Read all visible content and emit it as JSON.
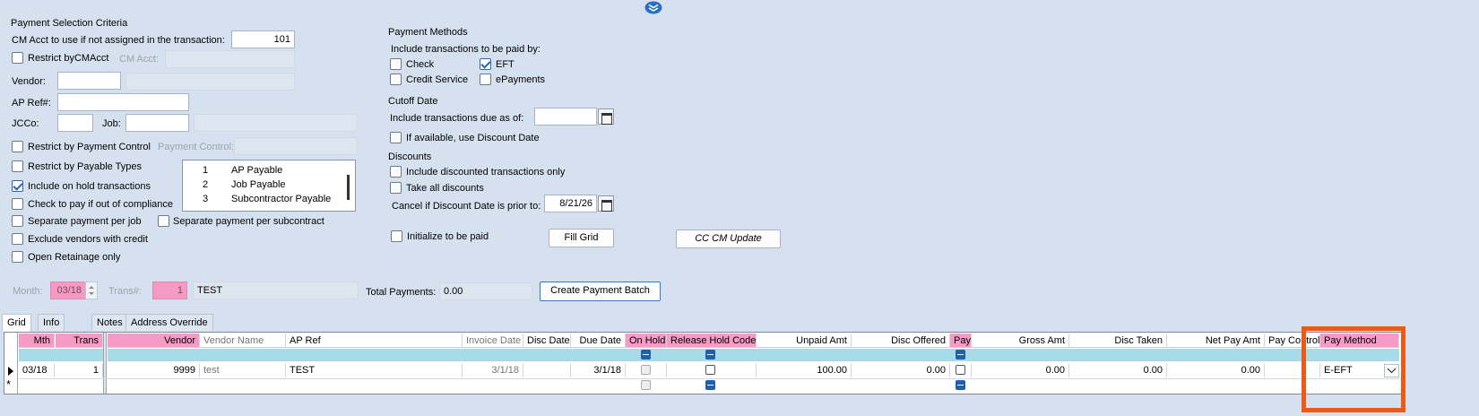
{
  "criteria": {
    "section_title": "Payment Selection Criteria",
    "cm_acct_label": "CM Acct to use if not assigned in the transaction:",
    "cm_acct_value": "101",
    "restrict_cmacct_label": "Restrict byCMAcct",
    "cm_acct_field_label": "CM Acct:",
    "vendor_label": "Vendor:",
    "ap_ref_label": "AP Ref#:",
    "jcco_label": "JCCo:",
    "job_label": "Job:",
    "restrict_payment_control_label": "Restrict by Payment Control",
    "payment_control_label": "Payment Control:",
    "restrict_payable_types_label": "Restrict by Payable Types",
    "include_on_hold_label": "Include on hold transactions",
    "check_to_pay_label": "Check to pay if out of compliance",
    "separate_per_job_label": "Separate payment per job",
    "separate_per_subcontract_label": "Separate payment per subcontract",
    "exclude_vendors_credit_label": "Exclude vendors with credit",
    "open_retainage_label": "Open Retainage only",
    "payable_types": [
      {
        "num": "1",
        "name": "AP Payable"
      },
      {
        "num": "2",
        "name": "Job Payable"
      },
      {
        "num": "3",
        "name": "Subcontractor Payable"
      }
    ]
  },
  "methods": {
    "title": "Payment Methods",
    "include_label": "Include transactions to be paid by:",
    "check_label": "Check",
    "eft_label": "EFT",
    "credit_service_label": "Credit Service",
    "epayments_label": "ePayments"
  },
  "cutoff": {
    "title": "Cutoff Date",
    "due_label": "Include transactions due as of:",
    "discount_date_label": "If available, use Discount Date"
  },
  "discounts": {
    "title": "Discounts",
    "include_discounted_label": "Include discounted transactions only",
    "take_all_label": "Take all discounts",
    "cancel_label": "Cancel if Discount Date is prior to:",
    "cancel_date": "8/21/26"
  },
  "actions": {
    "initialize_label": "Initialize to be paid",
    "fill_grid": "Fill Grid",
    "cc_cm_update": "CC CM Update",
    "create_batch": "Create Payment Batch"
  },
  "batch": {
    "month_label": "Month:",
    "month_value": "03/18",
    "trans_label": "Trans#:",
    "trans_value": "1",
    "description": "TEST",
    "total_label": "Total Payments:",
    "total_value": "0.00"
  },
  "tabs": [
    "Grid",
    "Info",
    "Notes",
    "Address Override"
  ],
  "grid": {
    "headers": {
      "mth": "Mth",
      "trans": "Trans",
      "vendor": "Vendor",
      "vendor_name": "Vendor Name",
      "ap_ref": "AP Ref",
      "invoice_date": "Invoice Date",
      "disc_date": "Disc Date",
      "due_date": "Due Date",
      "on_hold": "On Hold",
      "release_hold_code": "Release Hold Code",
      "unpaid_amt": "Unpaid Amt",
      "disc_offered": "Disc Offered",
      "pay": "Pay",
      "gross_amt": "Gross Amt",
      "disc_taken": "Disc Taken",
      "net_pay_amt": "Net Pay Amt",
      "pay_control": "Pay Control",
      "pay_method": "Pay Method"
    },
    "row": {
      "mth": "03/18",
      "trans": "1",
      "vendor": "9999",
      "vendor_name": "test",
      "ap_ref": "TEST",
      "invoice_date": "3/1/18",
      "due_date": "3/1/18",
      "unpaid_amt": "100.00",
      "disc_offered": "0.00",
      "gross_amt": "0.00",
      "disc_taken": "0.00",
      "net_pay_amt": "0.00",
      "pay_method": "E-EFT"
    },
    "new_row_marker": "*"
  },
  "colors": {
    "background": "#d6e1ef",
    "pink_header": "#f59bc6",
    "filter_row": "#a8dbe8",
    "highlight": "#ee5a14"
  },
  "icons": [
    "collapse-chevron-icon",
    "calendar-icon",
    "dropdown-chevron-icon",
    "row-pointer-icon"
  ]
}
